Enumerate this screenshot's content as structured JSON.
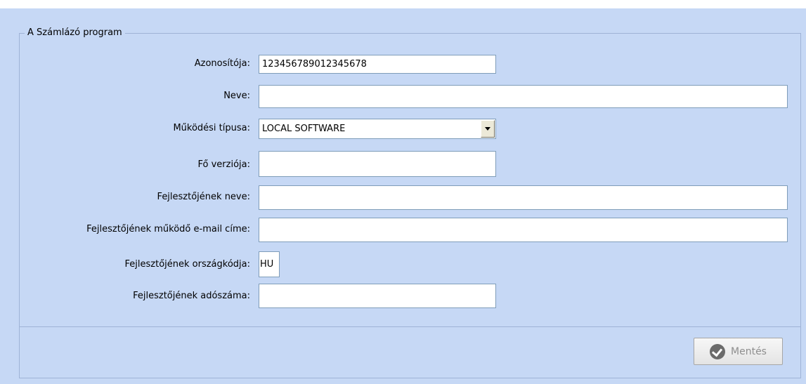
{
  "group": {
    "title": "A Számlázó program"
  },
  "fields": {
    "azonosito": {
      "label": "Azonosítója:",
      "value": "123456789012345678"
    },
    "neve": {
      "label": "Neve:",
      "value": ""
    },
    "mukodesi_tipus": {
      "label": "Működési típusa:",
      "value": "LOCAL SOFTWARE"
    },
    "fo_verzio": {
      "label": "Fő verziója:",
      "value": ""
    },
    "fejleszto_neve": {
      "label": "Fejlesztőjének neve:",
      "value": ""
    },
    "fejleszto_email": {
      "label": "Fejlesztőjének működő e-mail címe:",
      "value": ""
    },
    "fejleszto_orszagkod": {
      "label": "Fejlesztőjének országkódja:",
      "value": "HU"
    },
    "fejleszto_adoszam": {
      "label": "Fejlesztőjének adószáma:",
      "value": ""
    }
  },
  "actions": {
    "save_label": "Mentés",
    "save_icon": "check-circle-icon"
  }
}
